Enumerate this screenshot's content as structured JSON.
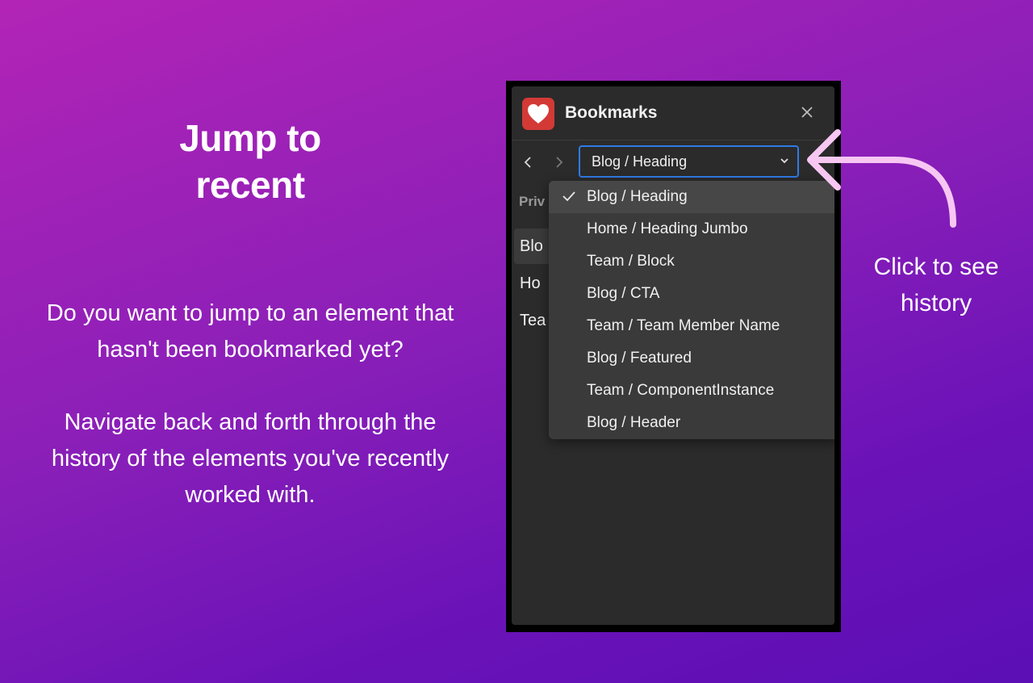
{
  "hero": {
    "title": "Jump to recent",
    "paragraphs": [
      "Do you want to jump to an element that hasn't been bookmarked yet?",
      "Navigate back and forth through the history of the elements you've recently worked with."
    ]
  },
  "panel": {
    "title": "Bookmarks",
    "logo_icon": "heart-icon",
    "accent_color": "#2f7be6",
    "logo_color": "#d33a36",
    "select": {
      "value": "Blog / Heading"
    },
    "section_label": "Priv",
    "list_items": [
      "Blo",
      "Ho",
      "Tea"
    ],
    "dropdown": {
      "items": [
        {
          "label": "Blog / Heading",
          "selected": true
        },
        {
          "label": "Home / Heading Jumbo",
          "selected": false
        },
        {
          "label": "Team / Block",
          "selected": false
        },
        {
          "label": "Blog / CTA",
          "selected": false
        },
        {
          "label": "Team / Team Member Name",
          "selected": false
        },
        {
          "label": "Blog / Featured",
          "selected": false
        },
        {
          "label": "Team / ComponentInstance",
          "selected": false
        },
        {
          "label": "Blog / Header",
          "selected": false
        }
      ]
    }
  },
  "callout": {
    "text": "Click to see history",
    "arrow_color": "#f7c7f2"
  }
}
